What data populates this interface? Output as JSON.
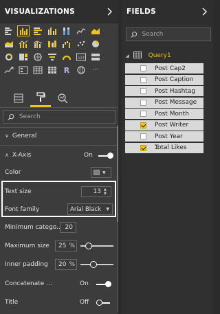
{
  "visualizations": {
    "title": "VISUALIZATIONS",
    "search_placeholder": "Search",
    "ellipsis": "···",
    "r_visual": "R",
    "card_number": "123",
    "general": {
      "label": "General"
    },
    "x_axis": {
      "label": "X-Axis",
      "state": "On"
    },
    "color": {
      "label": "Color"
    },
    "text_size": {
      "label": "Text size",
      "value": "13"
    },
    "font_family": {
      "label": "Font family",
      "value": "Arial Black"
    },
    "minimum_category": {
      "label": "Minimum catego...",
      "value": "20"
    },
    "maximum_size": {
      "label": "Maximum size",
      "value": "25",
      "unit": "%",
      "slider_fraction": 0.25
    },
    "inner_padding": {
      "label": "Inner padding",
      "value": "20",
      "unit": "%",
      "slider_fraction": 0.4
    },
    "concatenate": {
      "label": "Concatenate ...",
      "state": "On"
    },
    "title_row": {
      "label": "Title",
      "state": "Off"
    }
  },
  "fields": {
    "title": "FIELDS",
    "search_placeholder": "Search",
    "query_name": "Query1",
    "items": [
      {
        "name": "Post Cap2",
        "checked": false,
        "sigma": false
      },
      {
        "name": "Post Caption",
        "checked": false,
        "sigma": false
      },
      {
        "name": "Post Hashtag",
        "checked": false,
        "sigma": false
      },
      {
        "name": "Post Message",
        "checked": false,
        "sigma": false
      },
      {
        "name": "Post Month",
        "checked": false,
        "sigma": false
      },
      {
        "name": "Post Writer",
        "checked": true,
        "sigma": false
      },
      {
        "name": "Post Year",
        "checked": false,
        "sigma": false
      },
      {
        "name": "Total Likes",
        "checked": true,
        "sigma": true
      }
    ]
  },
  "colors": {
    "accent": "#f0c419",
    "pane_bg": "#3c3c3c",
    "field_bg": "#d9d9d9"
  }
}
